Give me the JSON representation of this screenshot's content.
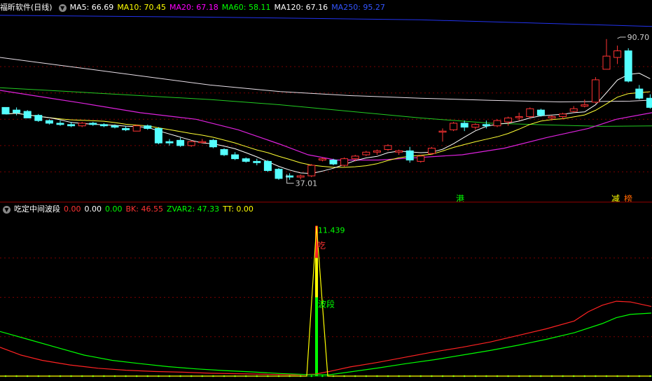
{
  "upper": {
    "title": "福昕软件(日线)",
    "mas": [
      {
        "label": "MA5: 66.69",
        "color": "#ffffff"
      },
      {
        "label": "MA10: 70.45",
        "color": "#ffff00"
      },
      {
        "label": "MA20: 67.18",
        "color": "#ff00ff"
      },
      {
        "label": "MA60: 58.11",
        "color": "#00ff00"
      },
      {
        "label": "MA120: 67.16",
        "color": "#ffffff"
      },
      {
        "label": "MA250: 95.27",
        "color": "#3355ff"
      }
    ],
    "high_label": "90.70",
    "low_label": "37.01",
    "signal_labels": [
      {
        "text": "港",
        "color": "#00ff00"
      },
      {
        "text": "减",
        "color": "#ffff00"
      },
      {
        "text": "榜",
        "color": "#ff6600"
      }
    ]
  },
  "lower": {
    "title": "吃定中间波段",
    "values": [
      {
        "label": "0.00",
        "color": "#ff3333"
      },
      {
        "label": "0.00",
        "color": "#ffffff"
      },
      {
        "label": "0.00",
        "color": "#00ff00"
      },
      {
        "label": "BK: 46.55",
        "color": "#ff3333"
      },
      {
        "label": "ZVAR2: 47.33",
        "color": "#00ff00"
      },
      {
        "label": "TT: 0.00",
        "color": "#ffff00"
      }
    ],
    "peak_label": "11.439",
    "chi_label": "吃",
    "bd_label": "波段"
  },
  "chart_data": [
    {
      "type": "candlestick",
      "title": "福昕软件(日线)",
      "ylim": [
        30,
        100
      ],
      "grid": true,
      "high_annotation": 90.7,
      "low_annotation": 37.01,
      "candles": [
        [
          64.5,
          64.5,
          62.0,
          62.0
        ],
        [
          63.5,
          64.5,
          61.5,
          62.5
        ],
        [
          63.0,
          63.5,
          60.5,
          60.5
        ],
        [
          61.5,
          62.0,
          59.0,
          59.5
        ],
        [
          59.5,
          60.0,
          58.0,
          58.5
        ],
        [
          58.5,
          59.5,
          57.5,
          58.0
        ],
        [
          58.0,
          59.0,
          57.0,
          57.5
        ],
        [
          57.5,
          59.0,
          57.0,
          58.5
        ],
        [
          58.5,
          59.0,
          57.5,
          58.0
        ],
        [
          58.0,
          58.5,
          57.0,
          57.5
        ],
        [
          57.5,
          58.0,
          56.5,
          57.0
        ],
        [
          56.5,
          57.5,
          55.5,
          56.0
        ],
        [
          55.5,
          58.0,
          55.5,
          57.5
        ],
        [
          57.5,
          58.0,
          56.0,
          56.5
        ],
        [
          56.5,
          57.0,
          50.5,
          51.0
        ],
        [
          51.5,
          52.5,
          50.0,
          51.0
        ],
        [
          52.0,
          53.0,
          49.5,
          50.0
        ],
        [
          50.0,
          52.0,
          49.5,
          51.5
        ],
        [
          51.5,
          52.5,
          51.0,
          51.5
        ],
        [
          52.0,
          52.5,
          49.0,
          49.5
        ],
        [
          48.5,
          49.0,
          46.0,
          46.5
        ],
        [
          46.5,
          47.5,
          44.5,
          45.0
        ],
        [
          45.0,
          45.5,
          43.5,
          44.0
        ],
        [
          44.0,
          45.0,
          42.5,
          43.5
        ],
        [
          44.0,
          44.5,
          40.0,
          40.5
        ],
        [
          41.0,
          41.5,
          37.0,
          37.5
        ],
        [
          38.5,
          39.5,
          37.0,
          38.0
        ],
        [
          38.0,
          39.0,
          37.2,
          38.5
        ],
        [
          38.5,
          43.0,
          38.0,
          42.5
        ],
        [
          44.5,
          45.5,
          44.0,
          45.0
        ],
        [
          44.5,
          45.0,
          42.5,
          43.0
        ],
        [
          42.5,
          45.5,
          42.0,
          45.0
        ],
        [
          45.0,
          46.5,
          44.0,
          46.0
        ],
        [
          46.5,
          48.0,
          46.0,
          47.5
        ],
        [
          47.5,
          48.5,
          46.5,
          48.0
        ],
        [
          48.5,
          50.5,
          48.0,
          50.0
        ],
        [
          47.5,
          48.5,
          46.5,
          48.0
        ],
        [
          48.0,
          49.5,
          43.5,
          44.5
        ],
        [
          44.0,
          46.5,
          43.5,
          46.0
        ],
        [
          47.0,
          49.5,
          46.5,
          49.0
        ],
        [
          55.5,
          56.5,
          51.5,
          55.5
        ],
        [
          56.0,
          59.0,
          55.5,
          58.5
        ],
        [
          58.5,
          59.5,
          55.5,
          57.0
        ],
        [
          57.0,
          58.5,
          56.0,
          58.0
        ],
        [
          58.0,
          59.5,
          56.5,
          57.5
        ],
        [
          57.5,
          60.0,
          57.0,
          59.5
        ],
        [
          59.0,
          61.0,
          57.5,
          60.5
        ],
        [
          61.0,
          62.5,
          59.5,
          61.0
        ],
        [
          61.0,
          64.5,
          60.5,
          64.0
        ],
        [
          63.5,
          64.0,
          61.0,
          61.5
        ],
        [
          60.5,
          61.5,
          59.5,
          61.0
        ],
        [
          61.0,
          62.5,
          60.0,
          62.0
        ],
        [
          63.0,
          65.0,
          62.5,
          64.0
        ],
        [
          65.0,
          67.5,
          64.5,
          65.5
        ],
        [
          66.5,
          76.0,
          66.0,
          75.0
        ],
        [
          79.0,
          90.5,
          79.0,
          84.0
        ],
        [
          83.5,
          88.0,
          81.0,
          86.0
        ],
        [
          86.0,
          87.0,
          74.0,
          74.5
        ],
        [
          71.5,
          73.0,
          67.5,
          68.0
        ],
        [
          68.0,
          69.5,
          64.0,
          64.5
        ]
      ]
    },
    {
      "type": "line",
      "title": "吃定中间波段",
      "ylim": [
        0,
        12
      ],
      "grid": true,
      "series": [
        {
          "name": "BK",
          "color": "#ff2222",
          "x": [
            0,
            30,
            60,
            100,
            140,
            180,
            220,
            260,
            300,
            340,
            380,
            420,
            450,
            470,
            500,
            540,
            580,
            620,
            660,
            700,
            740,
            780,
            820,
            840,
            860,
            880,
            900,
            930
          ],
          "values": [
            2.2,
            1.6,
            1.2,
            0.85,
            0.6,
            0.45,
            0.35,
            0.3,
            0.22,
            0.18,
            0.14,
            0.1,
            0.15,
            0.35,
            0.7,
            1.05,
            1.45,
            1.85,
            2.2,
            2.6,
            3.1,
            3.6,
            4.2,
            4.9,
            5.4,
            5.7,
            5.65,
            5.3
          ]
        },
        {
          "name": "ZVAR2",
          "color": "#00ff00",
          "x": [
            0,
            40,
            80,
            120,
            160,
            200,
            240,
            280,
            320,
            360,
            400,
            440,
            470,
            500,
            540,
            580,
            620,
            660,
            700,
            740,
            780,
            820,
            860,
            880,
            900,
            930
          ],
          "values": [
            3.4,
            2.8,
            2.2,
            1.6,
            1.2,
            0.95,
            0.72,
            0.55,
            0.42,
            0.32,
            0.2,
            0.12,
            0.1,
            0.32,
            0.62,
            0.95,
            1.25,
            1.6,
            1.95,
            2.35,
            2.8,
            3.3,
            4.0,
            4.45,
            4.7,
            4.8
          ]
        },
        {
          "name": "TT",
          "color": "#ffff00",
          "x": [
            0,
            438,
            452,
            468,
            930
          ],
          "values": [
            0,
            0,
            11.439,
            0,
            0
          ]
        }
      ]
    }
  ]
}
